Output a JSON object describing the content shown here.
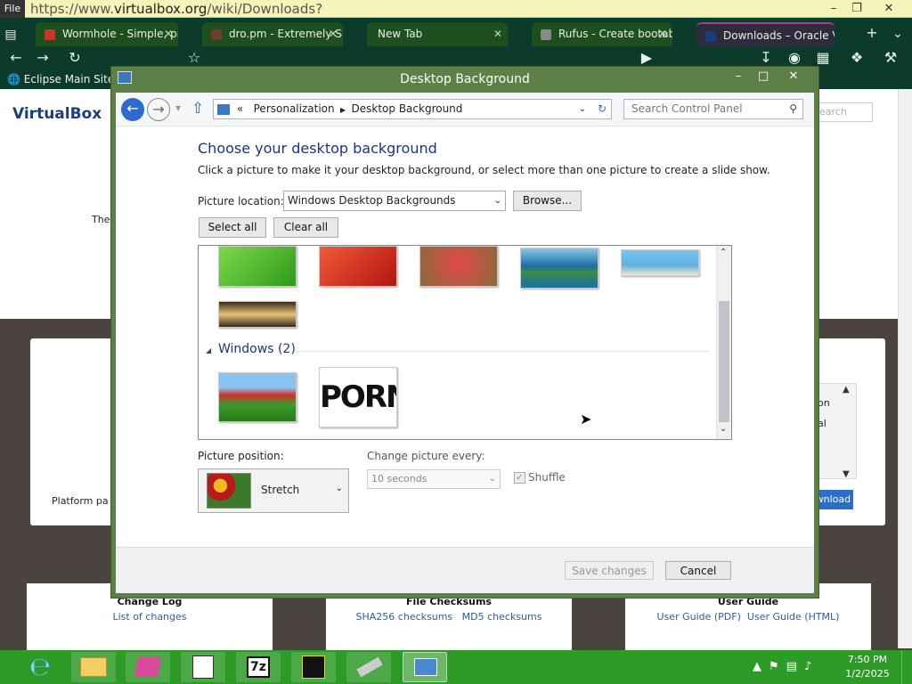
{
  "browser": {
    "menu_label": "File",
    "url_prefix": "https://www.",
    "url_domain": "virtualbox.org",
    "url_path": "/wiki/Downloads?",
    "tabs": [
      {
        "label": "Wormhole - Simple, pr",
        "favicon_color": "#c0392b"
      },
      {
        "label": "dro.pm - Extremely Sho",
        "favicon_color": "#6b3f2a"
      },
      {
        "label": "New Tab",
        "favicon_color": ""
      },
      {
        "label": "Rufus - Create bootabl",
        "favicon_color": "#8a8a8a"
      },
      {
        "label": "Downloads – Oracle Vi",
        "favicon_color": "#1b3d78"
      }
    ],
    "bookmark": "Eclipse Main Site",
    "icons": [
      "back-icon",
      "forward-icon",
      "reload-icon",
      "star-icon",
      "play-icon",
      "download-icon",
      "extension-icon",
      "page-icon",
      "puzzle-icon",
      "wrench-icon"
    ]
  },
  "webpage": {
    "logo_text": "VirtualBox",
    "search_placeholder": "Search",
    "side_text_left": "The",
    "platform_text": "Platform pa",
    "side_text_right_1": "on",
    "side_text_right_2": "al",
    "download_button": "ownload",
    "footer_cards": [
      {
        "title": "Change Log",
        "links": [
          "List of changes"
        ]
      },
      {
        "title": "File Checksums",
        "links": [
          "SHA256 checksums",
          "MD5 checksums"
        ]
      },
      {
        "title": "User Guide",
        "links": [
          "User Guide (PDF)",
          "User Guide (HTML)"
        ]
      }
    ]
  },
  "dialog": {
    "title": "Desktop Background",
    "breadcrumb": [
      "Personalization",
      "Desktop Background"
    ],
    "breadcrumb_prefix": "«",
    "search_placeholder": "Search Control Panel",
    "heading": "Choose your desktop background",
    "description": "Click a picture to make it your desktop background, or select more than one picture to create a slide show.",
    "picture_location_label": "Picture location:",
    "picture_location_value": "Windows Desktop Backgrounds",
    "browse_label": "Browse...",
    "select_all_label": "Select all",
    "clear_all_label": "Clear all",
    "group_name": "Windows (2)",
    "thumbs_row1": [
      "#53c22b",
      "#d8271a",
      "#c04a3c",
      "#2e7fb0",
      "#55a9d8"
    ],
    "thumbs_row2": [
      "#a3845c"
    ],
    "thumbs_windows": [
      "#c33b3b",
      "#ffffff"
    ],
    "windows_thumb_2_text": "PORN",
    "picture_position_label": "Picture position:",
    "picture_position_value": "Stretch",
    "change_picture_label": "Change picture every:",
    "change_picture_value": "10 seconds",
    "shuffle_label": "Shuffle",
    "save_label": "Save changes",
    "cancel_label": "Cancel"
  },
  "taskbar": {
    "time": "7:50 PM",
    "date": "1/2/2025",
    "apps": [
      "internet-explorer-icon",
      "file-explorer-icon",
      "pink-app-icon",
      "document-viewer-icon",
      "7zip-icon",
      "paint-app-icon",
      "usb-drive-icon",
      "control-panel-icon"
    ],
    "app_7zip_text": "7z",
    "tray_icons": [
      "caret-up-icon",
      "flag-icon",
      "network-icon",
      "volume-icon"
    ]
  },
  "colors": {
    "dialog_frame": "#5d7f48",
    "taskbar": "#2e9a28",
    "heading_blue": "#1e3287",
    "tab_strip": "#0d3b2b"
  }
}
